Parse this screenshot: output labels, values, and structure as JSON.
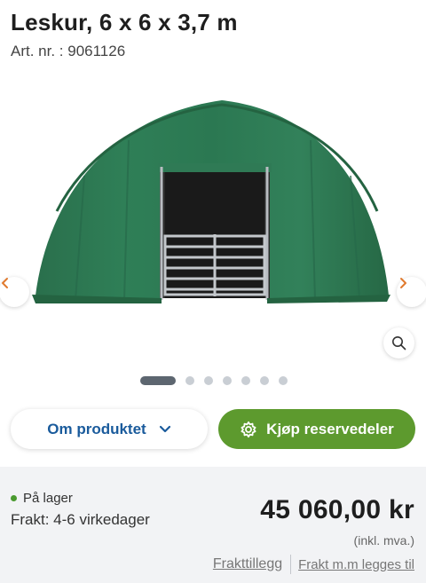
{
  "product": {
    "title": "Leskur, 6 x 6 x 3,7 m",
    "article_number": "Art. nr. : 9061126"
  },
  "gallery": {
    "image": "green arched tent shelter with open door and metal gate",
    "prev_icon": "chevron-left-icon",
    "next_icon": "chevron-right-icon",
    "zoom_icon": "search-icon",
    "slide_count": 7,
    "active_slide": 1,
    "colors": {
      "tent": "#2f7a55",
      "door": "#1d1d1d",
      "gate": "#b8bcc0",
      "nav_chevron": "#e07a2e"
    }
  },
  "actions": {
    "about_label": "Om produktet",
    "about_icon": "chevron-down-icon",
    "parts_label": "Kjøp reservedeler",
    "parts_icon": "gear-icon",
    "parts_color": "#5d9a2e"
  },
  "purchase": {
    "stock_status": "På lager",
    "shipping_time": "Frakt: 4-6 virkedager",
    "price": "45 060,00 kr",
    "vat_note": "(inkl. mva.)",
    "shipping_surcharge_link": "Frakttillegg",
    "shipping_added_link": "Frakt m.m legges til"
  }
}
